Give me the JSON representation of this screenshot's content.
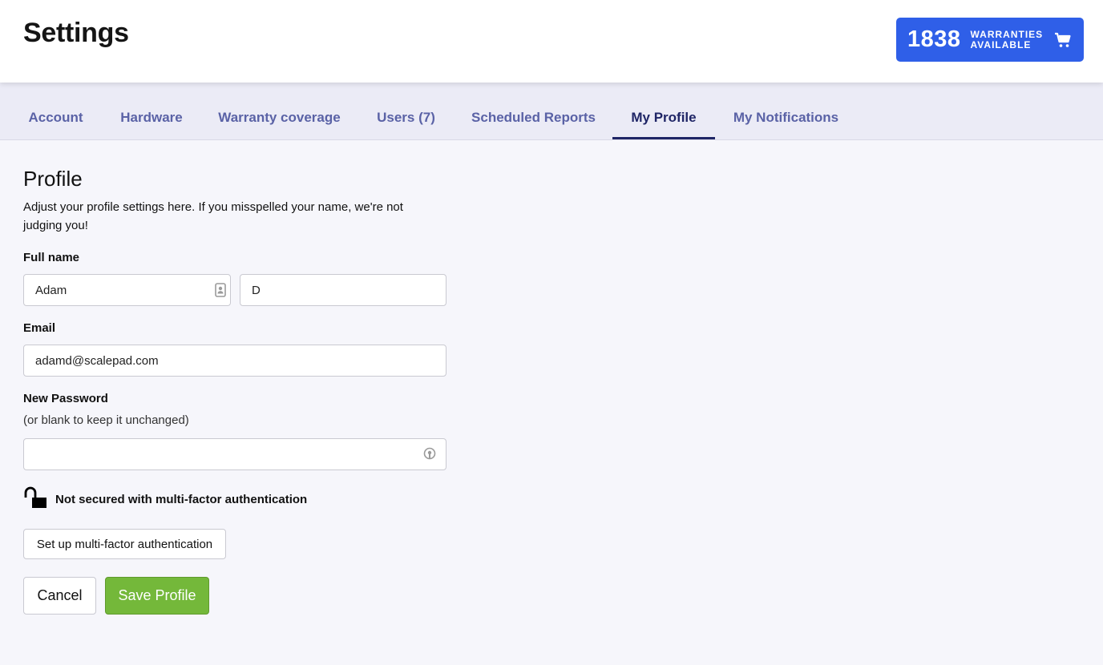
{
  "header": {
    "title": "Settings",
    "warranties": {
      "count": "1838",
      "label_line1": "WARRANTIES",
      "label_line2": "AVAILABLE",
      "icon": "cart-icon"
    }
  },
  "tabs": [
    {
      "label": "Account",
      "active": false
    },
    {
      "label": "Hardware",
      "active": false
    },
    {
      "label": "Warranty coverage",
      "active": false
    },
    {
      "label": "Users (7)",
      "active": false
    },
    {
      "label": "Scheduled Reports",
      "active": false
    },
    {
      "label": "My Profile",
      "active": true
    },
    {
      "label": "My Notifications",
      "active": false
    }
  ],
  "profile": {
    "title": "Profile",
    "description": "Adjust your profile settings here. If you misspelled your name, we're not judging you!",
    "full_name_label": "Full name",
    "first_name_value": "Adam",
    "last_name_value": "D",
    "email_label": "Email",
    "email_value": "adamd@scalepad.com",
    "password_label": "New Password",
    "password_hint": "(or blank to keep it unchanged)",
    "password_value": "",
    "mfa_status": "Not secured with multi-factor authentication",
    "mfa_button": "Set up multi-factor authentication",
    "cancel_button": "Cancel",
    "save_button": "Save Profile"
  },
  "colors": {
    "accent": "#2f5fe8",
    "tab_active": "#1f2566",
    "tab_inactive": "#5a62a6",
    "save": "#74b83a"
  }
}
